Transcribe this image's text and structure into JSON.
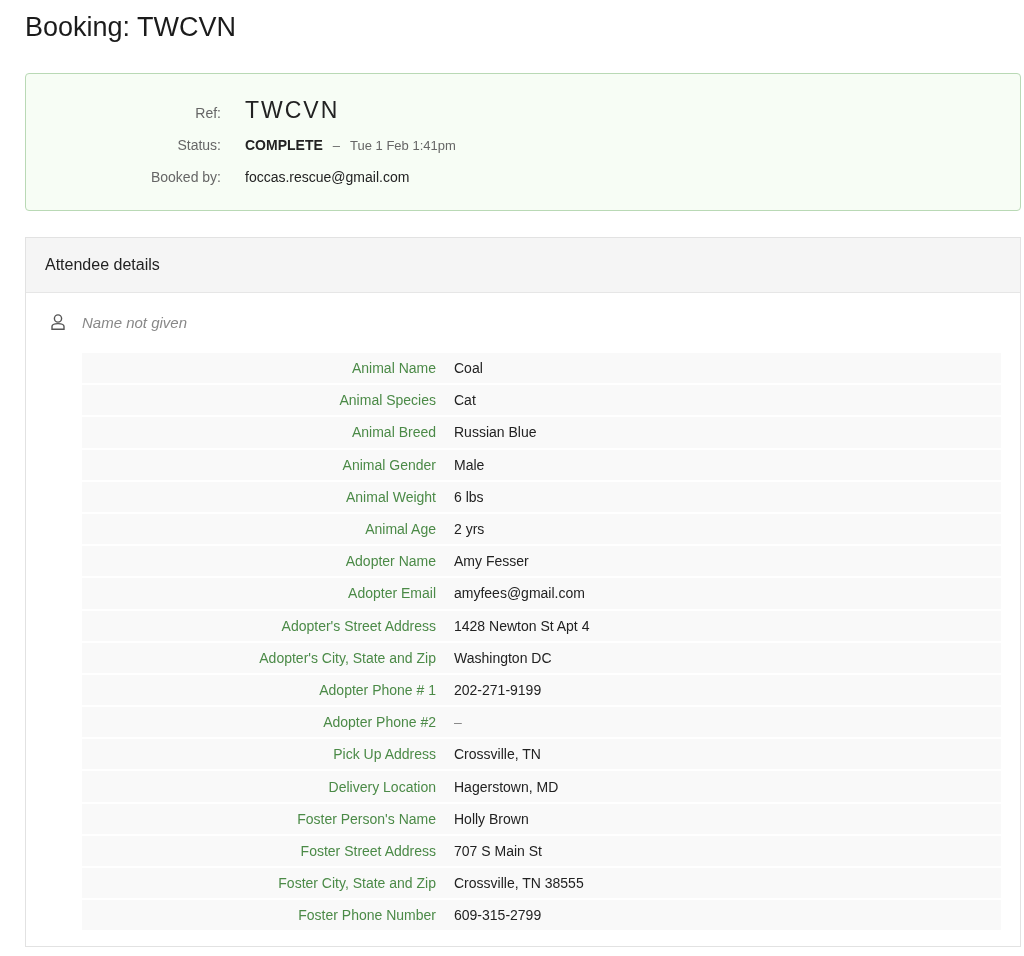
{
  "page_title": "Booking: TWCVN",
  "summary": {
    "ref": {
      "label": "Ref:",
      "value": "TWCVN"
    },
    "status": {
      "label": "Status:",
      "value": "COMPLETE",
      "separator": "–",
      "time": "Tue 1 Feb 1:41pm"
    },
    "booked_by": {
      "label": "Booked by:",
      "value": "foccas.rescue@gmail.com"
    }
  },
  "attendee_panel": {
    "title": "Attendee details",
    "attendee_name": "Name not given",
    "fields": [
      {
        "label": "Animal Name",
        "value": "Coal",
        "empty": false
      },
      {
        "label": "Animal Species",
        "value": "Cat",
        "empty": false
      },
      {
        "label": "Animal Breed",
        "value": "Russian Blue",
        "empty": false
      },
      {
        "label": "Animal Gender",
        "value": "Male",
        "empty": false
      },
      {
        "label": "Animal Weight",
        "value": "6 lbs",
        "empty": false
      },
      {
        "label": "Animal Age",
        "value": "2 yrs",
        "empty": false
      },
      {
        "label": "Adopter Name",
        "value": "Amy Fesser",
        "empty": false
      },
      {
        "label": "Adopter Email",
        "value": "amyfees@gmail.com",
        "empty": false
      },
      {
        "label": "Adopter's Street Address",
        "value": "1428 Newton St Apt 4",
        "empty": false
      },
      {
        "label": "Adopter's City, State and Zip",
        "value": "Washington DC",
        "empty": false
      },
      {
        "label": "Adopter Phone # 1",
        "value": "202-271-9199",
        "empty": false
      },
      {
        "label": "Adopter Phone #2",
        "value": "–",
        "empty": true
      },
      {
        "label": "Pick Up Address",
        "value": "Crossville, TN",
        "empty": false
      },
      {
        "label": "Delivery Location",
        "value": "Hagerstown, MD",
        "empty": false
      },
      {
        "label": "Foster Person's Name",
        "value": "Holly Brown",
        "empty": false
      },
      {
        "label": "Foster Street Address",
        "value": "707 S Main St",
        "empty": false
      },
      {
        "label": "Foster City, State and Zip",
        "value": "Crossville, TN 38555",
        "empty": false
      },
      {
        "label": "Foster Phone Number",
        "value": "609-315-2799",
        "empty": false
      }
    ]
  }
}
